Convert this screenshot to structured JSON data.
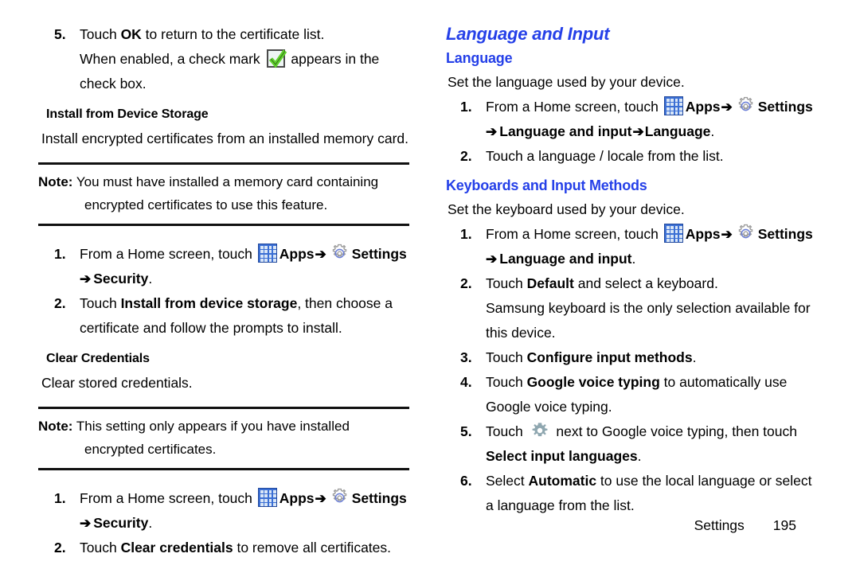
{
  "page": {
    "footer_section": "Settings",
    "footer_page_number": "195"
  },
  "colors": {
    "heading_blue": "#2540e8",
    "apps_icon_blue": "#3b6fd4",
    "apps_icon_tile": "#d9e6f7",
    "gear_outline_gray": "#9a9a9a",
    "gear_outline_inner_blue": "#6b7fd7",
    "gear_solid_gray": "#8fa7b0",
    "check_green": "#5fd12b",
    "rule_black": "#111111"
  },
  "icons": {
    "apps": "apps-grid-icon",
    "settings": "gear-outline-icon",
    "gear_solid": "gear-solid-icon",
    "checkmark": "green-checkmark-icon",
    "arrow": "right-arrow-icon"
  },
  "left_column": {
    "step5": {
      "num": "5.",
      "line1_pre": "Touch ",
      "line1_bold": "OK",
      "line1_post": " to return to the certificate list.",
      "line2_pre": "When enabled, a check mark ",
      "line2_post": " appears in the check box."
    },
    "install_from_device_storage": {
      "heading": "Install from Device Storage",
      "body": "Install encrypted certificates from an installed memory card."
    },
    "note1": {
      "label": "Note:",
      "text": " You must have installed a memory card containing encrypted certificates to use this feature."
    },
    "steps_security": {
      "step1": {
        "num": "1.",
        "pre": "From a Home screen, touch ",
        "apps_label": "Apps",
        "settings_label": "Settings",
        "arrow": "➔",
        "sub_bold": "Security",
        "sub_period": "."
      },
      "step2": {
        "num": "2.",
        "pre": "Touch ",
        "bold": "Install from device storage",
        "post": ", then choose a certificate and follow the prompts to install."
      }
    },
    "clear_credentials": {
      "heading": "Clear Credentials",
      "body": "Clear stored credentials."
    },
    "note2": {
      "label": "Note:",
      "text": " This setting only appears if you have installed encrypted certificates."
    },
    "steps_clear": {
      "step1": {
        "num": "1.",
        "pre": "From a Home screen, touch ",
        "apps_label": "Apps",
        "settings_label": "Settings",
        "arrow": "➔",
        "sub_bold": "Security",
        "sub_period": "."
      },
      "step2": {
        "num": "2.",
        "pre": "Touch ",
        "bold": "Clear credentials",
        "post": " to remove all certificates."
      }
    }
  },
  "right_column": {
    "section_title": "Language and Input",
    "language": {
      "heading": "Language",
      "intro": "Set the language used by your device.",
      "step1": {
        "num": "1.",
        "pre": "From a Home screen, touch ",
        "apps_label": "Apps",
        "settings_label": "Settings",
        "arrow": "➔",
        "sub_bold_1": "Language and input",
        "sub_arrow": "➔",
        "sub_bold_2": "Language",
        "sub_period": "."
      },
      "step2": {
        "num": "2.",
        "text": "Touch a language / locale from the list."
      }
    },
    "keyboards": {
      "heading": "Keyboards and Input Methods",
      "intro": "Set the keyboard used by your device.",
      "step1": {
        "num": "1.",
        "pre": "From a Home screen, touch ",
        "apps_label": "Apps",
        "settings_label": "Settings",
        "arrow": "➔",
        "sub_bold_1": "Language and input",
        "sub_period": "."
      },
      "step2": {
        "num": "2.",
        "pre": "Touch ",
        "bold": "Default",
        "post": " and select a keyboard.",
        "cont": "Samsung keyboard is the only selection available for this device."
      },
      "step3": {
        "num": "3.",
        "pre": "Touch ",
        "bold": "Configure input methods",
        "post": "."
      },
      "step4": {
        "num": "4.",
        "pre": "Touch ",
        "bold": "Google voice typing",
        "post": " to automatically use Google voice typing."
      },
      "step5": {
        "num": "5.",
        "pre": "Touch ",
        "mid": " next to Google voice typing, then touch ",
        "bold": "Select input languages",
        "post": "."
      },
      "step6": {
        "num": "6.",
        "pre": "Select ",
        "bold": "Automatic",
        "post": " to use the local language or select a language from the list."
      }
    }
  }
}
